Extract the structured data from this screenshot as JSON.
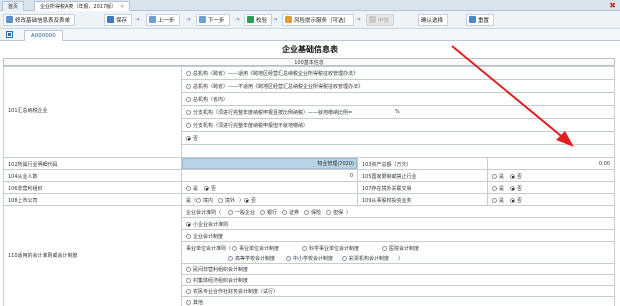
{
  "tabs": [
    {
      "label": "首页"
    },
    {
      "label": "企业所得税A类（年报，2017版）"
    }
  ],
  "toolbar": {
    "btn_fill_info": "修改基础信息表及表单",
    "btn_save": "保存",
    "btn_prev": "上一步",
    "btn_next": "下一步",
    "btn_check": "校验",
    "btn_risk": "风险提示服务（可选）",
    "btn_declare": "申报",
    "btn_confirm": "确认选择",
    "btn_reset": "重置"
  },
  "sheet": {
    "tab": "A000000"
  },
  "form": {
    "title": "企业基础信息表",
    "section": "100基本信息",
    "r101": {
      "label": "101汇总纳税企业",
      "options": [
        "总机构（跨省）——适用《跨地区经营汇总纳税企业所得税征收管理办法》",
        "总机构（跨省）——不适用《跨地区经营汇总纳税企业所得税征收管理办法》",
        "总机构（省内）",
        "分支机构（须进行完整年度纳税申报且按比例纳税）——就地缴纳比例=",
        "分支机构（须进行完整年度纳税申报但不就地缴纳）",
        "否"
      ],
      "percent": "%"
    },
    "r102": {
      "label": "102所属行业明细代码",
      "value": "物业管理(7020)"
    },
    "r103": {
      "label": "103资产总额（万元）",
      "value": "0.00"
    },
    "r104": {
      "label": "104从业人数",
      "value": "0"
    },
    "r105": {
      "label": "105国家限制或禁止行业",
      "opt_yes": "是",
      "opt_no": "否"
    },
    "r106": {
      "label": "106非营利组织",
      "opt_yes": "是",
      "opt_no": "否"
    },
    "r107": {
      "label": "107存在境外关联交易",
      "opt_yes": "是",
      "opt_no": "否"
    },
    "r108": {
      "label": "108上市公司",
      "opt_yes": "是（",
      "opt_domestic": "境内",
      "opt_abroad": "境外",
      "close": "）",
      "opt_no": "否"
    },
    "r109": {
      "label": "109从事股权投资业务",
      "opt_yes": "是",
      "opt_no": "否"
    },
    "r110": {
      "label": "110适用的会计准则或会计制度",
      "standard_line": "企业会计准则（",
      "standard_items": [
        "一般企业",
        "银行",
        "证券",
        "保险",
        "担保"
      ],
      "standard_close": "）",
      "small_standard": "小企业会计准则",
      "enterprise_system": "企业会计制度",
      "public_line": "事业单位会计准则（",
      "public_items": [
        "事业单位会计制度",
        "科学事业单位会计制度",
        "医院会计制度",
        "高等学校会计制度",
        "中小学校会计制度",
        "彩票机构会计制度"
      ],
      "public_close": "）",
      "npo": "民间非营利组织会计制度",
      "village": "村集体经济组织会计制度",
      "farm": "农民专业合作社财务会计制度（试行）",
      "other": "其他"
    }
  },
  "colors": {
    "accent": "#2f6fb6",
    "annotation": "#e02020",
    "input_fill": "#b8d3e6"
  }
}
